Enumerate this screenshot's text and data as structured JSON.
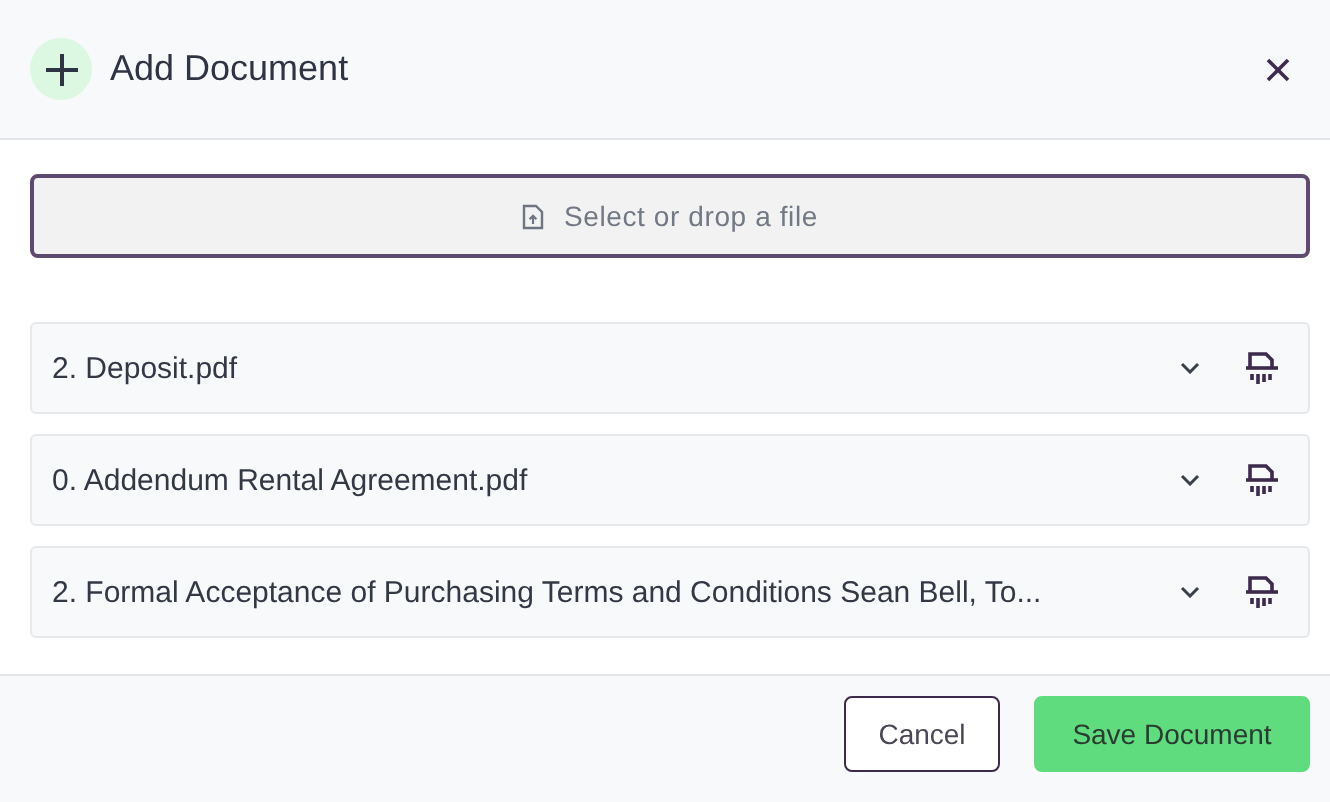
{
  "dialog": {
    "title": "Add Document"
  },
  "dropzone": {
    "label": "Select or drop a file"
  },
  "documents": [
    {
      "name": "2. Deposit.pdf"
    },
    {
      "name": "0. Addendum Rental Agreement.pdf"
    },
    {
      "name": "2. Formal Acceptance of Purchasing Terms and Conditions Sean Bell, To..."
    }
  ],
  "buttons": [
    {
      "label": "Cancel",
      "kind": "secondary"
    },
    {
      "label": "Save Document",
      "kind": "primary"
    }
  ]
}
